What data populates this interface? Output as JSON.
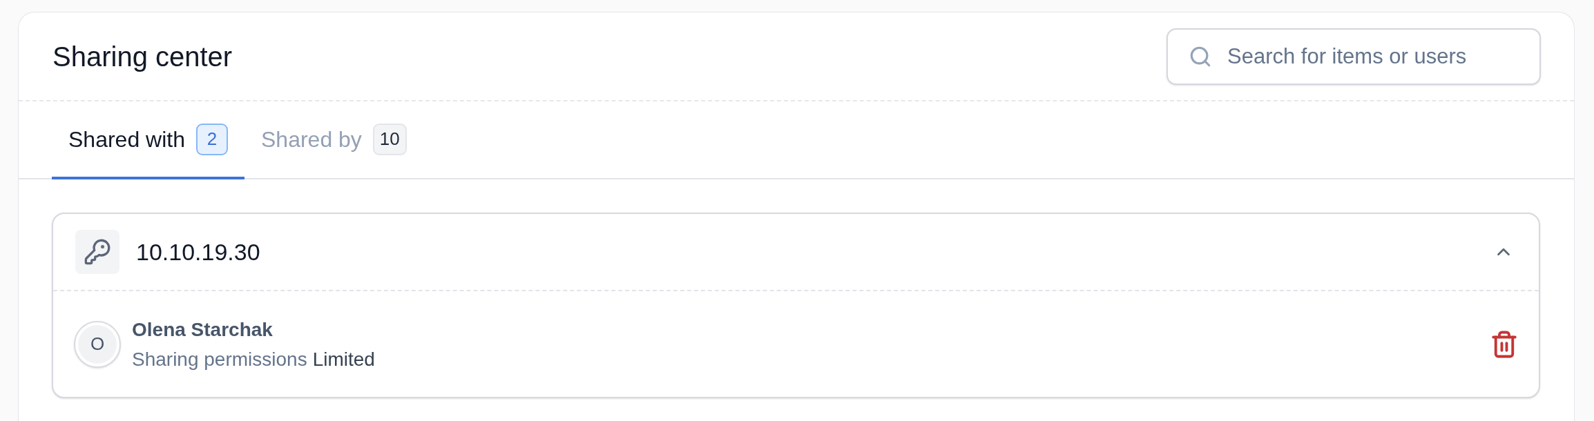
{
  "header": {
    "title": "Sharing center",
    "search": {
      "placeholder": "Search for items or users"
    }
  },
  "tabs": [
    {
      "label": "Shared with",
      "count": "2",
      "selected": true
    },
    {
      "label": "Shared by",
      "count": "10",
      "selected": false
    }
  ],
  "items": [
    {
      "title": "10.10.19.30",
      "expanded": true,
      "shares": [
        {
          "initial": "O",
          "name": "Olena Starchak",
          "permission_label": "Sharing permissions",
          "permission": "Limited"
        }
      ]
    }
  ]
}
